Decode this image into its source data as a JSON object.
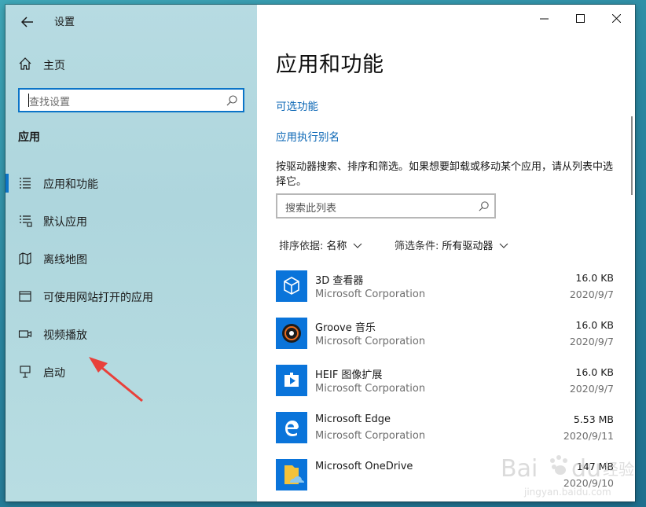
{
  "window": {
    "title": "设置",
    "controls": {
      "minimize": "—",
      "maximize": "☐",
      "close": "✕"
    }
  },
  "sidebar": {
    "home_label": "主页",
    "search_placeholder": "查找设置",
    "section_title": "应用",
    "items": [
      {
        "label": "应用和功能",
        "icon": "list-icon",
        "selected": true
      },
      {
        "label": "默认应用",
        "icon": "default-apps-icon",
        "selected": false
      },
      {
        "label": "离线地图",
        "icon": "map-icon",
        "selected": false
      },
      {
        "label": "可使用网站打开的应用",
        "icon": "web-apps-icon",
        "selected": false
      },
      {
        "label": "视频播放",
        "icon": "video-icon",
        "selected": false
      },
      {
        "label": "启动",
        "icon": "startup-icon",
        "selected": false
      }
    ]
  },
  "main": {
    "page_title": "应用和功能",
    "optional_features_link": "可选功能",
    "app_alias_link": "应用执行别名",
    "description": "按驱动器搜索、排序和筛选。如果想要卸载或移动某个应用，请从列表中选择它。",
    "list_search_placeholder": "搜索此列表",
    "sort": {
      "label": "排序依据:",
      "value": "名称"
    },
    "filter": {
      "label": "筛选条件:",
      "value": "所有驱动器"
    },
    "apps": [
      {
        "name": "3D 查看器",
        "publisher": "Microsoft Corporation",
        "size": "16.0 KB",
        "date": "2020/9/7",
        "icon": "3d-viewer-icon"
      },
      {
        "name": "Groove 音乐",
        "publisher": "Microsoft Corporation",
        "size": "16.0 KB",
        "date": "2020/9/7",
        "icon": "groove-music-icon"
      },
      {
        "name": "HEIF 图像扩展",
        "publisher": "Microsoft Corporation",
        "size": "16.0 KB",
        "date": "2020/9/7",
        "icon": "heif-extension-icon"
      },
      {
        "name": "Microsoft Edge",
        "publisher": "Microsoft Corporation",
        "size": "5.53 MB",
        "date": "2020/9/11",
        "icon": "edge-icon"
      },
      {
        "name": "Microsoft OneDrive",
        "publisher": "",
        "size": "147 MB",
        "date": "2020/9/10",
        "icon": "onedrive-icon"
      }
    ]
  },
  "colors": {
    "accent": "#0b74c8",
    "link": "#0a66b5",
    "tile": "#0a74da"
  }
}
